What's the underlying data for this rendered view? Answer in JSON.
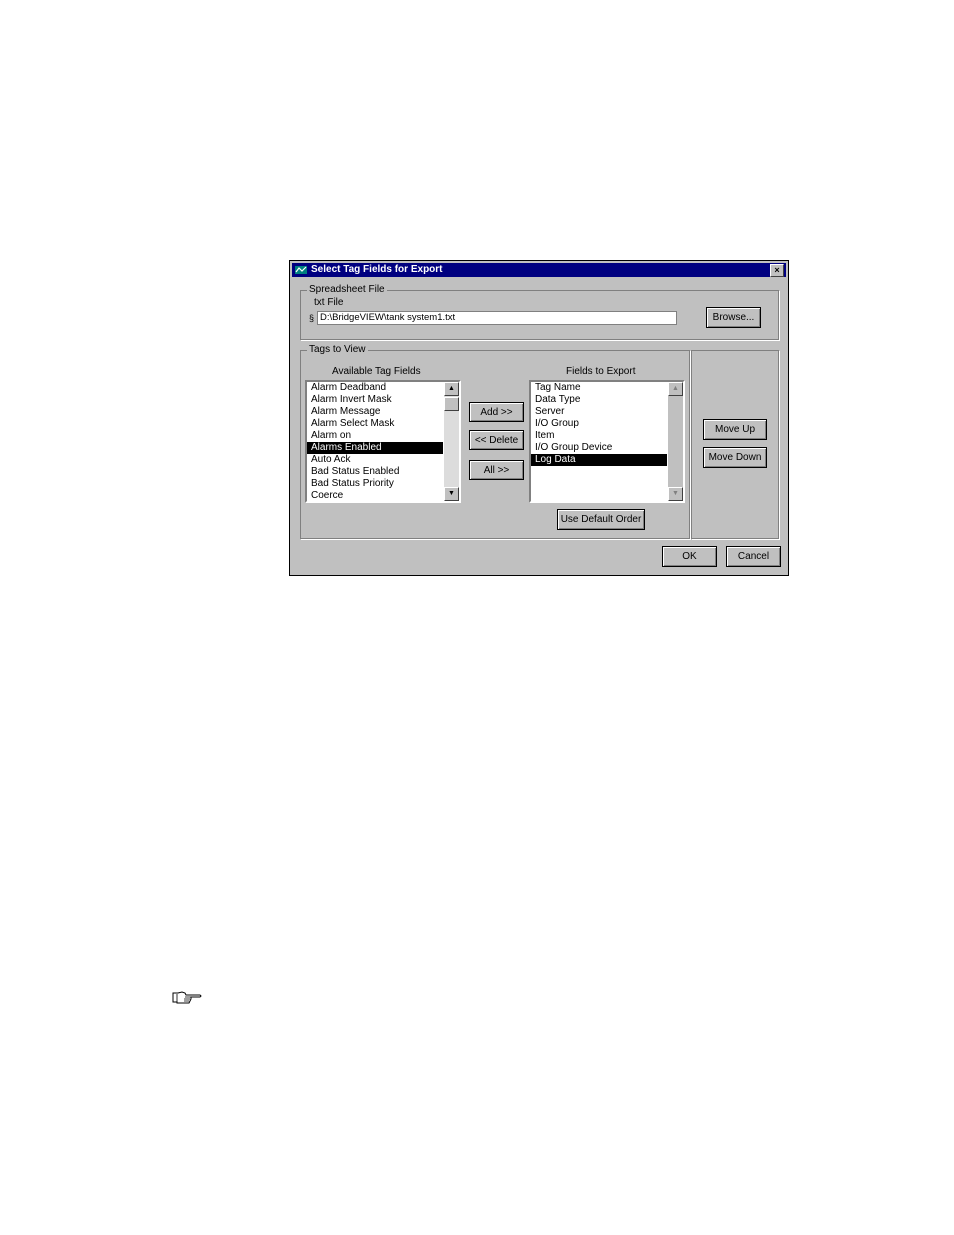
{
  "dialog": {
    "title": "Select Tag Fields for Export",
    "close_glyph": "×",
    "spreadsheet_group": {
      "legend": "Spreadsheet File",
      "file_label": "txt File",
      "file_icon_glyph": "§",
      "file_path": "D:\\BridgeVIEW\\tank system1.txt",
      "browse_label": "Browse..."
    },
    "tags_group": {
      "legend": "Tags to View",
      "available_label": "Available Tag Fields",
      "available_items": [
        "Alarm Deadband",
        "Alarm Invert Mask",
        "Alarm Message",
        "Alarm Select Mask",
        "Alarm on",
        "Alarms Enabled",
        "Auto Ack",
        "Bad Status Enabled",
        "Bad Status Priority",
        "Coerce"
      ],
      "available_selected": "Alarms Enabled",
      "add_label": "Add >>",
      "delete_label": "<< Delete",
      "all_label": "All >>",
      "export_label": "Fields to Export",
      "export_items": [
        "Tag Name",
        "Data Type",
        "Server",
        "I/O Group",
        "Item",
        "I/O Group Device",
        "Log Data"
      ],
      "export_selected": "Log Data",
      "default_order_label": "Use Default Order"
    },
    "move_up_label": "Move Up",
    "move_down_label": "Move Down",
    "ok_label": "OK",
    "cancel_label": "Cancel"
  },
  "icons": {
    "window_icon": "bridgeview-window-icon",
    "note_icon": "pointing-hand-icon"
  }
}
